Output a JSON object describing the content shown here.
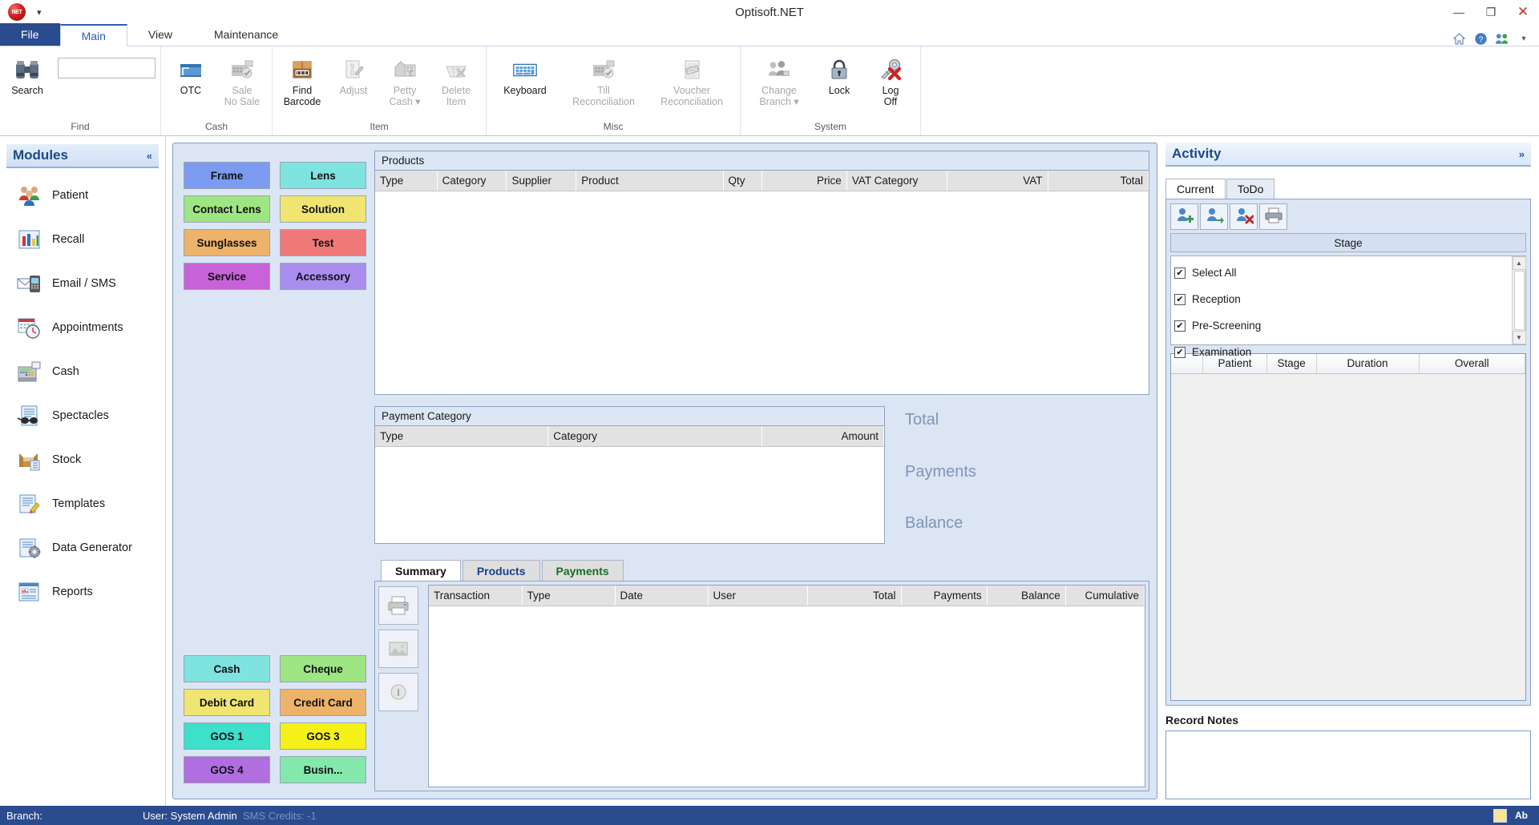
{
  "window": {
    "title": "Optisoft.NET",
    "logo_text": "NET",
    "quick_access_caret": "▾",
    "minimize": "—",
    "restore": "❐",
    "close": "✕",
    "ribbon_collapse": "▾"
  },
  "ribbon": {
    "tabs": [
      {
        "label": "File",
        "state": "file"
      },
      {
        "label": "Main",
        "state": "active"
      },
      {
        "label": "View",
        "state": "normal"
      },
      {
        "label": "Maintenance",
        "state": "normal"
      }
    ],
    "right_icons": [
      "home-icon",
      "help-icon",
      "people-icon"
    ],
    "groups": [
      {
        "name": "Find",
        "label": "Find",
        "items": [
          {
            "label": "Search",
            "icon": "binoculars-icon",
            "disabled": false
          }
        ],
        "input": {
          "value": "",
          "placeholder": ""
        }
      },
      {
        "name": "Cash",
        "label": "Cash",
        "items": [
          {
            "label": "OTC",
            "icon": "otc-icon",
            "disabled": false
          },
          {
            "label": "Sale",
            "icon": "sale-register-icon",
            "disabled": true
          },
          {
            "label": "No\nSale",
            "icon": "no-sale-register-icon",
            "disabled": true
          }
        ]
      },
      {
        "name": "Item",
        "label": "Item",
        "items": [
          {
            "label": "Find\nBarcode",
            "icon": "barcode-box-icon",
            "disabled": false
          },
          {
            "label": "Adjust",
            "icon": "adjust-page-icon",
            "disabled": true
          },
          {
            "label": "Petty\nCash ▾",
            "icon": "petty-cash-icon",
            "disabled": true
          },
          {
            "label": "Delete\nItem",
            "icon": "delete-basket-icon",
            "disabled": true
          }
        ]
      },
      {
        "name": "Misc",
        "label": "Misc",
        "items": [
          {
            "label": "Keyboard",
            "icon": "keyboard-icon",
            "disabled": false
          },
          {
            "label": "Till\nReconciliation",
            "icon": "till-icon",
            "disabled": true
          },
          {
            "label": "Voucher\nReconciliation",
            "icon": "voucher-paid-icon",
            "disabled": true
          }
        ]
      },
      {
        "name": "System",
        "label": "System",
        "items": [
          {
            "label": "Change\nBranch ▾",
            "icon": "people-group-icon",
            "disabled": true
          },
          {
            "label": "Lock",
            "icon": "padlock-icon",
            "disabled": false
          },
          {
            "label": "Log\nOff",
            "icon": "key-delete-icon",
            "disabled": false
          }
        ]
      }
    ]
  },
  "sidebar": {
    "header": "Modules",
    "collapse_glyph": "«",
    "items": [
      {
        "label": "Patient",
        "icon": "people-icon"
      },
      {
        "label": "Recall",
        "icon": "bar-chart-icon"
      },
      {
        "label": "Email / SMS",
        "icon": "email-phone-icon"
      },
      {
        "label": "Appointments",
        "icon": "calendar-clock-icon"
      },
      {
        "label": "Cash",
        "icon": "cash-register-icon"
      },
      {
        "label": "Spectacles",
        "icon": "spectacles-doc-icon"
      },
      {
        "label": "Stock",
        "icon": "stock-box-icon"
      },
      {
        "label": "Templates",
        "icon": "template-doc-icon"
      },
      {
        "label": "Data Generator",
        "icon": "data-generator-icon"
      },
      {
        "label": "Reports",
        "icon": "reports-icon"
      }
    ]
  },
  "main": {
    "category_buttons": [
      {
        "label": "Frame",
        "color": "#7a9bf0"
      },
      {
        "label": "Lens",
        "color": "#7fe3e0"
      },
      {
        "label": "Contact Lens",
        "color": "#9ee583"
      },
      {
        "label": "Solution",
        "color": "#f0e571"
      },
      {
        "label": "Sunglasses",
        "color": "#edb36a"
      },
      {
        "label": "Test",
        "color": "#ef7878"
      },
      {
        "label": "Service",
        "color": "#c763d9"
      },
      {
        "label": "Accessory",
        "color": "#a98ef0"
      }
    ],
    "payment_buttons": [
      {
        "label": "Cash",
        "color": "#7fe3e0"
      },
      {
        "label": "Cheque",
        "color": "#9ee583"
      },
      {
        "label": "Debit Card",
        "color": "#f0e571"
      },
      {
        "label": "Credit Card",
        "color": "#edb36a"
      },
      {
        "label": "GOS 1",
        "color": "#3de0c8"
      },
      {
        "label": "GOS 3",
        "color": "#f5f018"
      },
      {
        "label": "GOS 4",
        "color": "#b06ee0"
      },
      {
        "label": "Busin...",
        "color": "#84e8ac"
      }
    ],
    "products": {
      "title": "Products",
      "columns": [
        {
          "label": "Type",
          "align": "left",
          "width": "8%"
        },
        {
          "label": "Category",
          "align": "left",
          "width": "9%"
        },
        {
          "label": "Supplier",
          "align": "left",
          "width": "9%"
        },
        {
          "label": "Product",
          "align": "left",
          "width": "19%"
        },
        {
          "label": "Qty",
          "align": "left",
          "width": "5%"
        },
        {
          "label": "Price",
          "align": "right",
          "width": "11%"
        },
        {
          "label": "VAT Category",
          "align": "left",
          "width": "13%"
        },
        {
          "label": "VAT",
          "align": "right",
          "width": "13%"
        },
        {
          "label": "Total",
          "align": "right",
          "width": "13%"
        }
      ],
      "rows": []
    },
    "payment_category": {
      "title": "Payment Category",
      "columns": [
        {
          "label": "Type",
          "align": "left",
          "width": "34%"
        },
        {
          "label": "Category",
          "align": "left",
          "width": "42%"
        },
        {
          "label": "Amount",
          "align": "right",
          "width": "24%"
        }
      ],
      "rows": []
    },
    "totals": [
      {
        "label": "Total"
      },
      {
        "label": "Payments"
      },
      {
        "label": "Balance"
      }
    ],
    "bottom_tabs": [
      {
        "label": "Summary",
        "state": "active"
      },
      {
        "label": "Products",
        "state": "blue"
      },
      {
        "label": "Payments",
        "state": "green"
      }
    ],
    "side_icons": [
      "printer-icon",
      "export-icon",
      "info-icon"
    ],
    "summary": {
      "columns": [
        {
          "label": "Transaction",
          "align": "left",
          "width": "13%"
        },
        {
          "label": "Type",
          "align": "left",
          "width": "13%"
        },
        {
          "label": "Date",
          "align": "left",
          "width": "13%"
        },
        {
          "label": "User",
          "align": "left",
          "width": "14%"
        },
        {
          "label": "Total",
          "align": "right",
          "width": "13%"
        },
        {
          "label": "Payments",
          "align": "right",
          "width": "12%"
        },
        {
          "label": "Balance",
          "align": "right",
          "width": "11%"
        },
        {
          "label": "Cumulative",
          "align": "right",
          "width": "11%"
        }
      ],
      "rows": []
    }
  },
  "activity": {
    "header": "Activity",
    "expand_glyph": "»",
    "tabs": [
      {
        "label": "Current",
        "state": "active"
      },
      {
        "label": "ToDo",
        "state": "normal"
      }
    ],
    "toolbar": [
      {
        "icon": "add-patient-icon"
      },
      {
        "icon": "move-patient-icon"
      },
      {
        "icon": "remove-patient-icon"
      },
      {
        "icon": "print-icon"
      }
    ],
    "stage_button": "Stage",
    "stage_items": [
      {
        "label": "Select All",
        "checked": true
      },
      {
        "label": "Reception",
        "checked": true
      },
      {
        "label": "Pre-Screening",
        "checked": true
      },
      {
        "label": "Examination",
        "checked": true
      }
    ],
    "scroll_up": "▲",
    "scroll_down": "▼",
    "grid_columns": [
      {
        "label": "",
        "width": "9%"
      },
      {
        "label": "Patient",
        "width": "18%"
      },
      {
        "label": "Stage",
        "width": "14%"
      },
      {
        "label": "Duration",
        "width": "29%"
      },
      {
        "label": "Overall",
        "width": "30%"
      }
    ],
    "grid_rows": [],
    "notes_header": "Record Notes",
    "notes_value": ""
  },
  "statusbar": {
    "branch": "Branch:",
    "user": "User: System Admin",
    "sms_credits": "SMS Credits: -1",
    "right_glyph": "Ab"
  },
  "colors": {
    "accent": "#2a4b8d",
    "panel": "#dbe5f4",
    "header_text": "#1c4a8b"
  }
}
